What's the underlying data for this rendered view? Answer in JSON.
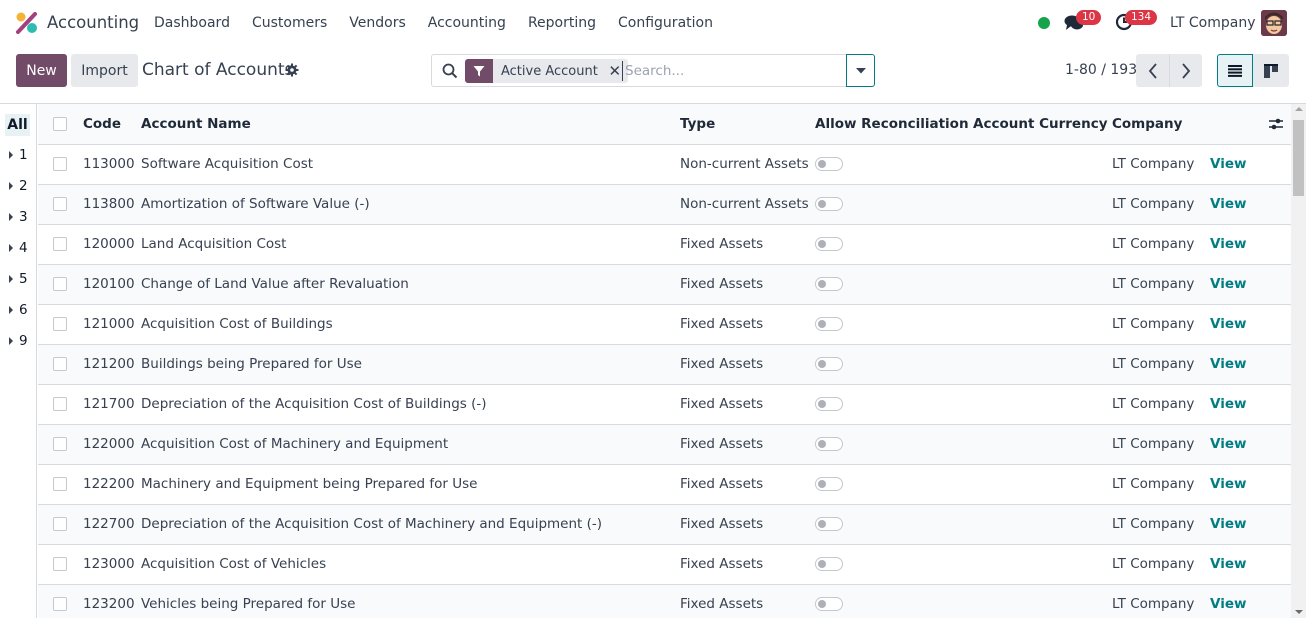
{
  "navbar": {
    "app_name": "Accounting",
    "menu": [
      "Dashboard",
      "Customers",
      "Vendors",
      "Accounting",
      "Reporting",
      "Configuration"
    ],
    "chat_count": "10",
    "activity_count": "134",
    "company": "LT Company",
    "presence_color": "#16a34a",
    "badge_color": "#dc3545"
  },
  "control": {
    "new_label": "New",
    "import_label": "Import",
    "title": "Chart of Accounts",
    "search": {
      "facet_label": "Active Account",
      "placeholder": "Search...",
      "value": ""
    },
    "pager": "1-80 / 193",
    "brand_color": "#714b67",
    "accent_color": "#017e84"
  },
  "sidepanel": {
    "all_label": "All",
    "groups": [
      "1",
      "2",
      "3",
      "4",
      "5",
      "6",
      "9"
    ]
  },
  "table": {
    "headers": {
      "code": "Code",
      "name": "Account Name",
      "type": "Type",
      "reconcile": "Allow Reconciliation",
      "currency": "Account Currency",
      "company": "Company"
    },
    "rows": [
      {
        "code": "113000",
        "name": "Software Acquisition Cost",
        "type": "Non-current Assets",
        "reconcile": false,
        "currency": "",
        "company": "LT Company",
        "action": "View"
      },
      {
        "code": "113800",
        "name": "Amortization of Software Value (-)",
        "type": "Non-current Assets",
        "reconcile": false,
        "currency": "",
        "company": "LT Company",
        "action": "View"
      },
      {
        "code": "120000",
        "name": "Land Acquisition Cost",
        "type": "Fixed Assets",
        "reconcile": false,
        "currency": "",
        "company": "LT Company",
        "action": "View"
      },
      {
        "code": "120100",
        "name": "Change of Land Value after Revaluation",
        "type": "Fixed Assets",
        "reconcile": false,
        "currency": "",
        "company": "LT Company",
        "action": "View"
      },
      {
        "code": "121000",
        "name": "Acquisition Cost of Buildings",
        "type": "Fixed Assets",
        "reconcile": false,
        "currency": "",
        "company": "LT Company",
        "action": "View"
      },
      {
        "code": "121200",
        "name": "Buildings being Prepared for Use",
        "type": "Fixed Assets",
        "reconcile": false,
        "currency": "",
        "company": "LT Company",
        "action": "View"
      },
      {
        "code": "121700",
        "name": "Depreciation of the Acquisition Cost of Buildings (-)",
        "type": "Fixed Assets",
        "reconcile": false,
        "currency": "",
        "company": "LT Company",
        "action": "View"
      },
      {
        "code": "122000",
        "name": "Acquisition Cost of Machinery and Equipment",
        "type": "Fixed Assets",
        "reconcile": false,
        "currency": "",
        "company": "LT Company",
        "action": "View"
      },
      {
        "code": "122200",
        "name": "Machinery and Equipment being Prepared for Use",
        "type": "Fixed Assets",
        "reconcile": false,
        "currency": "",
        "company": "LT Company",
        "action": "View"
      },
      {
        "code": "122700",
        "name": "Depreciation of the Acquisition Cost of Machinery and Equipment (-)",
        "type": "Fixed Assets",
        "reconcile": false,
        "currency": "",
        "company": "LT Company",
        "action": "View"
      },
      {
        "code": "123000",
        "name": "Acquisition Cost of Vehicles",
        "type": "Fixed Assets",
        "reconcile": false,
        "currency": "",
        "company": "LT Company",
        "action": "View"
      },
      {
        "code": "123200",
        "name": "Vehicles being Prepared for Use",
        "type": "Fixed Assets",
        "reconcile": false,
        "currency": "",
        "company": "LT Company",
        "action": "View"
      }
    ]
  }
}
